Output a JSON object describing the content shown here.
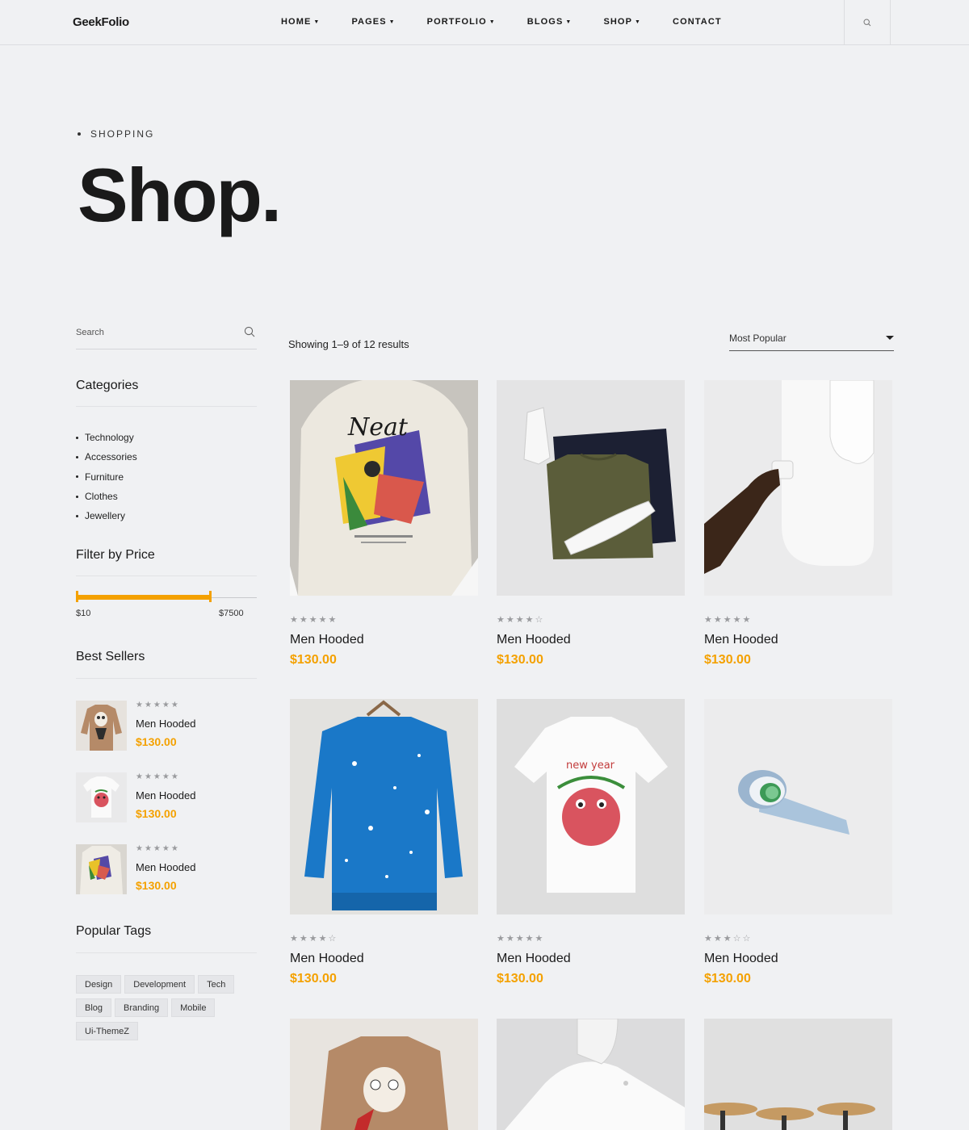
{
  "header": {
    "logo": "GeekFolio",
    "nav": [
      {
        "label": "HOME",
        "caret": true
      },
      {
        "label": "PAGES",
        "caret": true
      },
      {
        "label": "PORTFOLIO",
        "caret": true
      },
      {
        "label": "BLOGS",
        "caret": true
      },
      {
        "label": "SHOP",
        "caret": true
      },
      {
        "label": "CONTACT",
        "caret": false
      }
    ]
  },
  "hero": {
    "crumb": "SHOPPING",
    "title": "Shop."
  },
  "sidebar": {
    "search": {
      "placeholder": "Search"
    },
    "categories_title": "Categories",
    "categories": [
      "Technology",
      "Accessories",
      "Furniture",
      "Clothes",
      "Jewellery"
    ],
    "price_title": "Filter by Price",
    "price_min": "$10",
    "price_max": "$7500",
    "price_range_fraction": [
      0,
      0.75
    ],
    "best_title": "Best Sellers",
    "best_sellers": [
      {
        "name": "Men Hooded",
        "price": "$130.00",
        "rating": 5,
        "thumb": "brown-sweater"
      },
      {
        "name": "Men Hooded",
        "price": "$130.00",
        "rating": 5,
        "thumb": "white-tshirt"
      },
      {
        "name": "Men Hooded",
        "price": "$130.00",
        "rating": 5,
        "thumb": "neat-hoodie"
      }
    ],
    "tags_title": "Popular Tags",
    "tags": [
      "Design",
      "Development",
      "Tech",
      "Blog",
      "Branding",
      "Mobile",
      "Ui-ThemeZ"
    ]
  },
  "main": {
    "results": "Showing 1–9 of 12 results",
    "sort": "Most Popular"
  },
  "products": [
    {
      "name": "Men Hooded",
      "price": "$130.00",
      "rating": 5,
      "image": "neat-hoodie"
    },
    {
      "name": "Men Hooded",
      "price": "$130.00",
      "rating": 4,
      "image": "sneakers-tshirt"
    },
    {
      "name": "Men Hooded",
      "price": "$130.00",
      "rating": 5,
      "image": "white-device"
    },
    {
      "name": "Men Hooded",
      "price": "$130.00",
      "rating": 4,
      "image": "blue-sweatshirt"
    },
    {
      "name": "Men Hooded",
      "price": "$130.00",
      "rating": 5,
      "image": "white-tshirt"
    },
    {
      "name": "Men Hooded",
      "price": "$130.00",
      "rating": 3,
      "image": "tape-dispenser"
    },
    {
      "name": "",
      "price": "",
      "rating": 0,
      "image": "brown-sweater"
    },
    {
      "name": "",
      "price": "",
      "rating": 0,
      "image": "white-gadget"
    },
    {
      "name": "",
      "price": "",
      "rating": 0,
      "image": "wooden-stools"
    }
  ],
  "colors": {
    "accent": "#f4a100",
    "background": "#f0f1f3",
    "text": "#1a1a1a"
  }
}
